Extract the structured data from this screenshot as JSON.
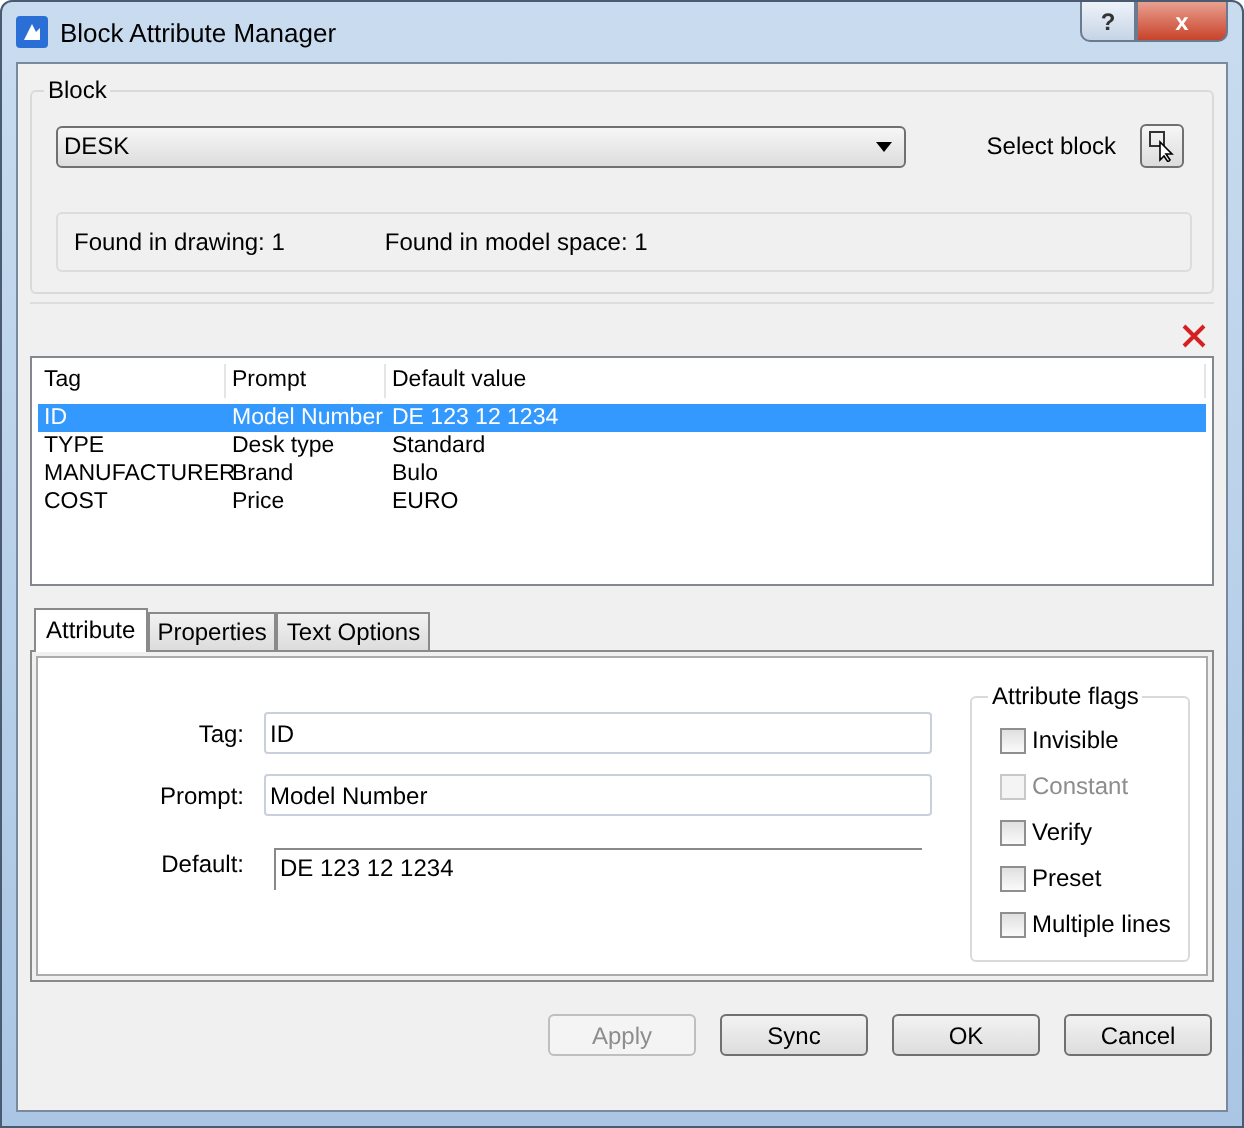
{
  "window": {
    "title": "Block Attribute Manager",
    "buttons": [
      "?",
      "x"
    ]
  },
  "block": {
    "group_label": "Block",
    "selected_block": "DESK",
    "select_label": "Select block",
    "found_in_drawing": "Found in drawing: 1",
    "found_in_model_space": "Found in model space: 1"
  },
  "table": {
    "columns": [
      "Tag",
      "Prompt",
      "Default value"
    ],
    "rows": [
      {
        "cells": [
          "ID",
          "Model Number",
          "DE 123 12 1234"
        ],
        "selected": true
      },
      {
        "cells": [
          "TYPE",
          "Desk type",
          "Standard"
        ],
        "selected": false
      },
      {
        "cells": [
          "MANUFACTURER",
          "Brand",
          "Bulo"
        ],
        "selected": false
      },
      {
        "cells": [
          "COST",
          "Price",
          "EURO"
        ],
        "selected": false
      }
    ]
  },
  "tabs": [
    {
      "label": "Attribute",
      "selected": true
    },
    {
      "label": "Properties",
      "selected": false
    },
    {
      "label": "Text Options",
      "selected": false
    }
  ],
  "attribute": {
    "fields": [
      {
        "label": "Tag:",
        "value": "ID",
        "kind": "box"
      },
      {
        "label": "Prompt:",
        "value": "Model Number",
        "kind": "box"
      },
      {
        "label": "Default:",
        "value": "DE 123 12 1234",
        "kind": "line"
      }
    ],
    "flags_label": "Attribute flags",
    "flags": [
      {
        "label": "Invisible",
        "checked": false,
        "disabled": false
      },
      {
        "label": "Constant",
        "checked": false,
        "disabled": true
      },
      {
        "label": "Verify",
        "checked": false,
        "disabled": false
      },
      {
        "label": "Preset",
        "checked": false,
        "disabled": false
      },
      {
        "label": "Multiple lines",
        "checked": false,
        "disabled": false
      }
    ]
  },
  "buttons": [
    {
      "label": "Apply",
      "disabled": true
    },
    {
      "label": "Sync",
      "disabled": false
    },
    {
      "label": "OK",
      "disabled": false
    },
    {
      "label": "Cancel",
      "disabled": false
    }
  ]
}
